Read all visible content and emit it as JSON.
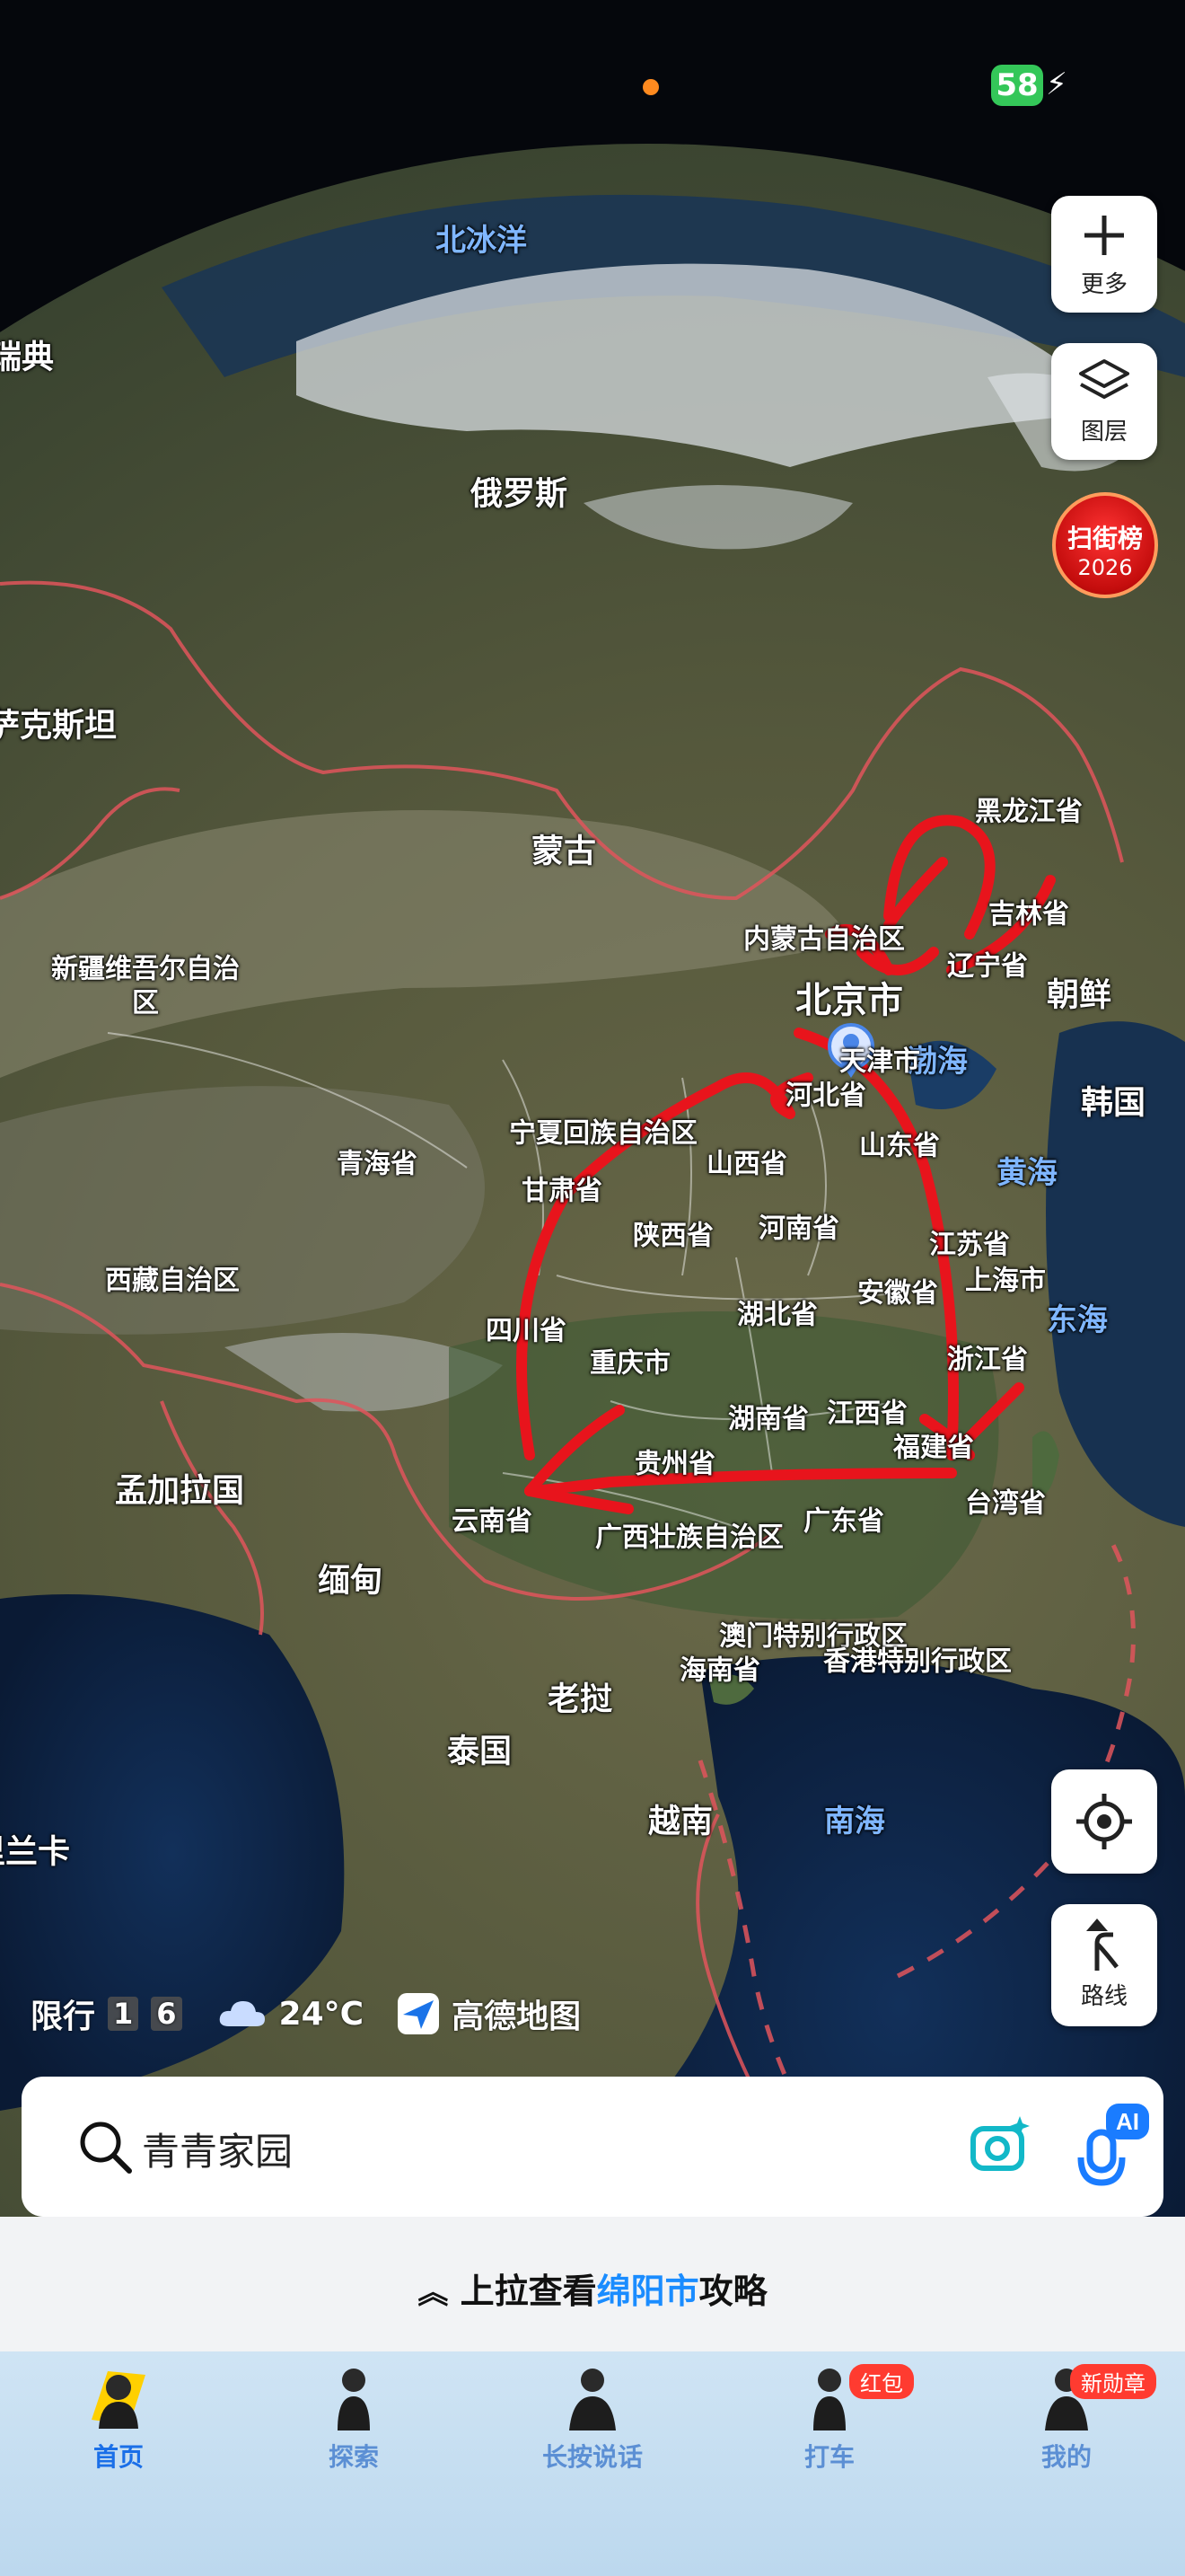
{
  "status_bar": {
    "battery": "58"
  },
  "map": {
    "countries": [
      "北冰洋",
      "瑞典",
      "俄罗斯",
      "哈萨克斯坦",
      "蒙古",
      "朝鲜",
      "韩国",
      "孟加拉国",
      "缅甸",
      "老挝",
      "泰国",
      "越南",
      "斯里兰卡"
    ],
    "seas": [
      "渤海",
      "黄海",
      "东海",
      "南海"
    ],
    "provinces": [
      "黑龙江省",
      "吉林省",
      "辽宁省",
      "内蒙古自治区",
      "北京市",
      "天津市",
      "河北省",
      "新疆维吾尔自治区",
      "宁夏回族自治区",
      "青海省",
      "甘肃省",
      "山西省",
      "山东省",
      "陕西省",
      "河南省",
      "江苏省",
      "上海市",
      "西藏自治区",
      "四川省",
      "湖北省",
      "安徽省",
      "浙江省",
      "重庆市",
      "湖南省",
      "江西省",
      "福建省",
      "贵州省",
      "台湾省",
      "云南省",
      "广西壮族自治区",
      "广东省",
      "澳门特别行政区",
      "香港特别行政区",
      "海南省"
    ],
    "annotation_color": "#e8141c"
  },
  "controls": {
    "more_label": "更多",
    "layers_label": "图层",
    "rank_line1": "扫街榜",
    "rank_line2": "2026",
    "route_label": "路线"
  },
  "info": {
    "restriction_label": "限行",
    "restriction_digit1": "1",
    "restriction_digit2": "6",
    "temperature": "24°C",
    "brand": "高德地图"
  },
  "search": {
    "text": "青青家园"
  },
  "pull_up": {
    "prefix": "上拉查看",
    "city": "绵阳市",
    "suffix": "攻略"
  },
  "tabs": [
    {
      "label": "首页"
    },
    {
      "label": "探索"
    },
    {
      "label": "长按说话"
    },
    {
      "label": "打车",
      "badge": "红包"
    },
    {
      "label": "我的",
      "badge": "新勋章"
    }
  ]
}
